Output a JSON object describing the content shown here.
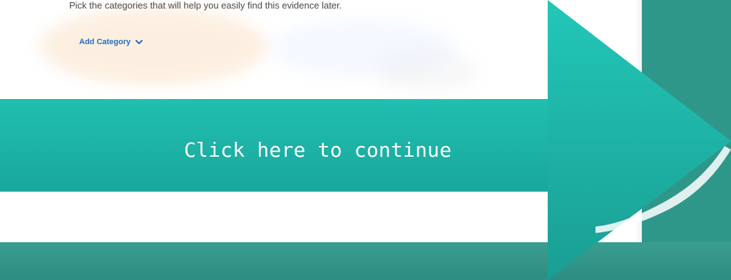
{
  "panel": {
    "instruction_text": "Pick the categories that will help you easily find this evidence later.",
    "add_category_label": "Add Category",
    "add_category_icon": "chevron-down-icon",
    "link_color": "#1f6fc1"
  },
  "cta": {
    "label": "Click here to continue",
    "arrow_color_top": "#22c7b8",
    "arrow_color_bottom": "#1a9e93",
    "text_color": "#ffffff"
  },
  "theme": {
    "background_teal": "#2f978a",
    "card_white": "#ffffff",
    "text_gray": "#4a4a4a"
  }
}
